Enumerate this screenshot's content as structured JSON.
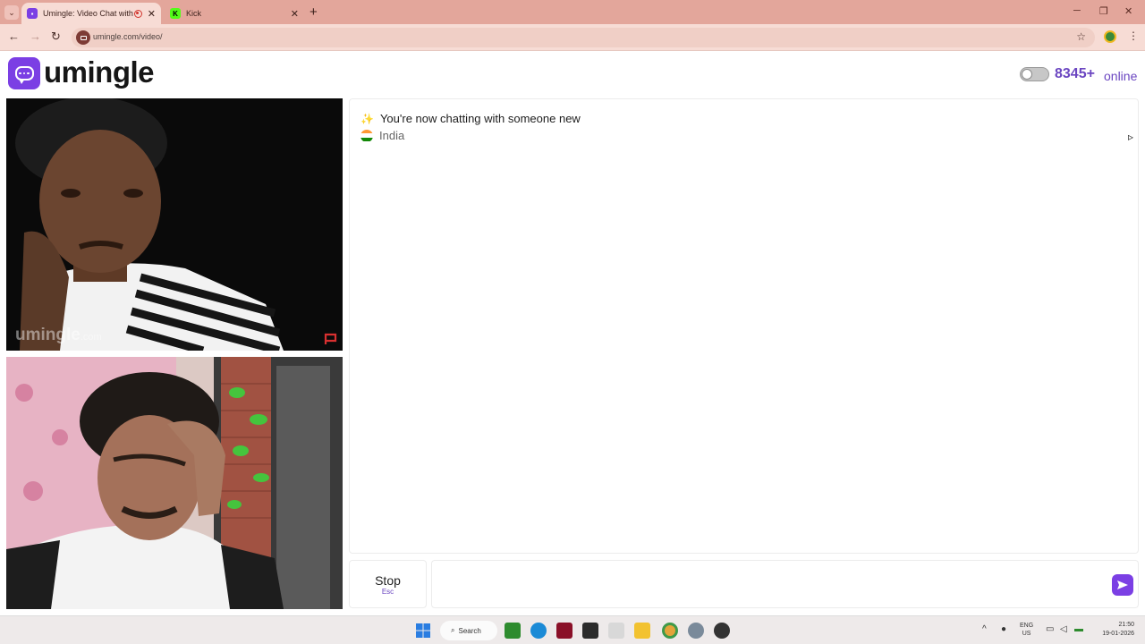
{
  "browser": {
    "tabs": [
      {
        "title": "Umingle: Video Chat with S",
        "active": true
      },
      {
        "title": "Kick",
        "active": false
      }
    ],
    "url": "umingle.com/video/"
  },
  "header": {
    "brand": "umingle",
    "online_count": "8345+",
    "online_label": "online"
  },
  "video": {
    "watermark_main": "umingle",
    "watermark_suffix": ".com"
  },
  "chat": {
    "system_message": "You're now chatting with someone new",
    "country": "India",
    "input_placeholder": ""
  },
  "controls": {
    "stop_label": "Stop",
    "stop_shortcut": "Esc"
  },
  "taskbar": {
    "search_label": "Search",
    "lang_top": "ENG",
    "lang_bottom": "US",
    "time": "21:50",
    "date": "19-01-2026"
  },
  "colors": {
    "accent": "#7b3fe4",
    "online_text": "#6b46c1",
    "tab_strip": "#e3a69b"
  },
  "icons": [
    "search-icon",
    "recording-icon",
    "close-icon",
    "plus-icon",
    "back-icon",
    "forward-icon",
    "reload-icon",
    "star-icon",
    "menu-icon",
    "chat-bubble-icon",
    "sparkle-icon",
    "india-flag-icon",
    "send-icon",
    "windows-start-icon"
  ]
}
